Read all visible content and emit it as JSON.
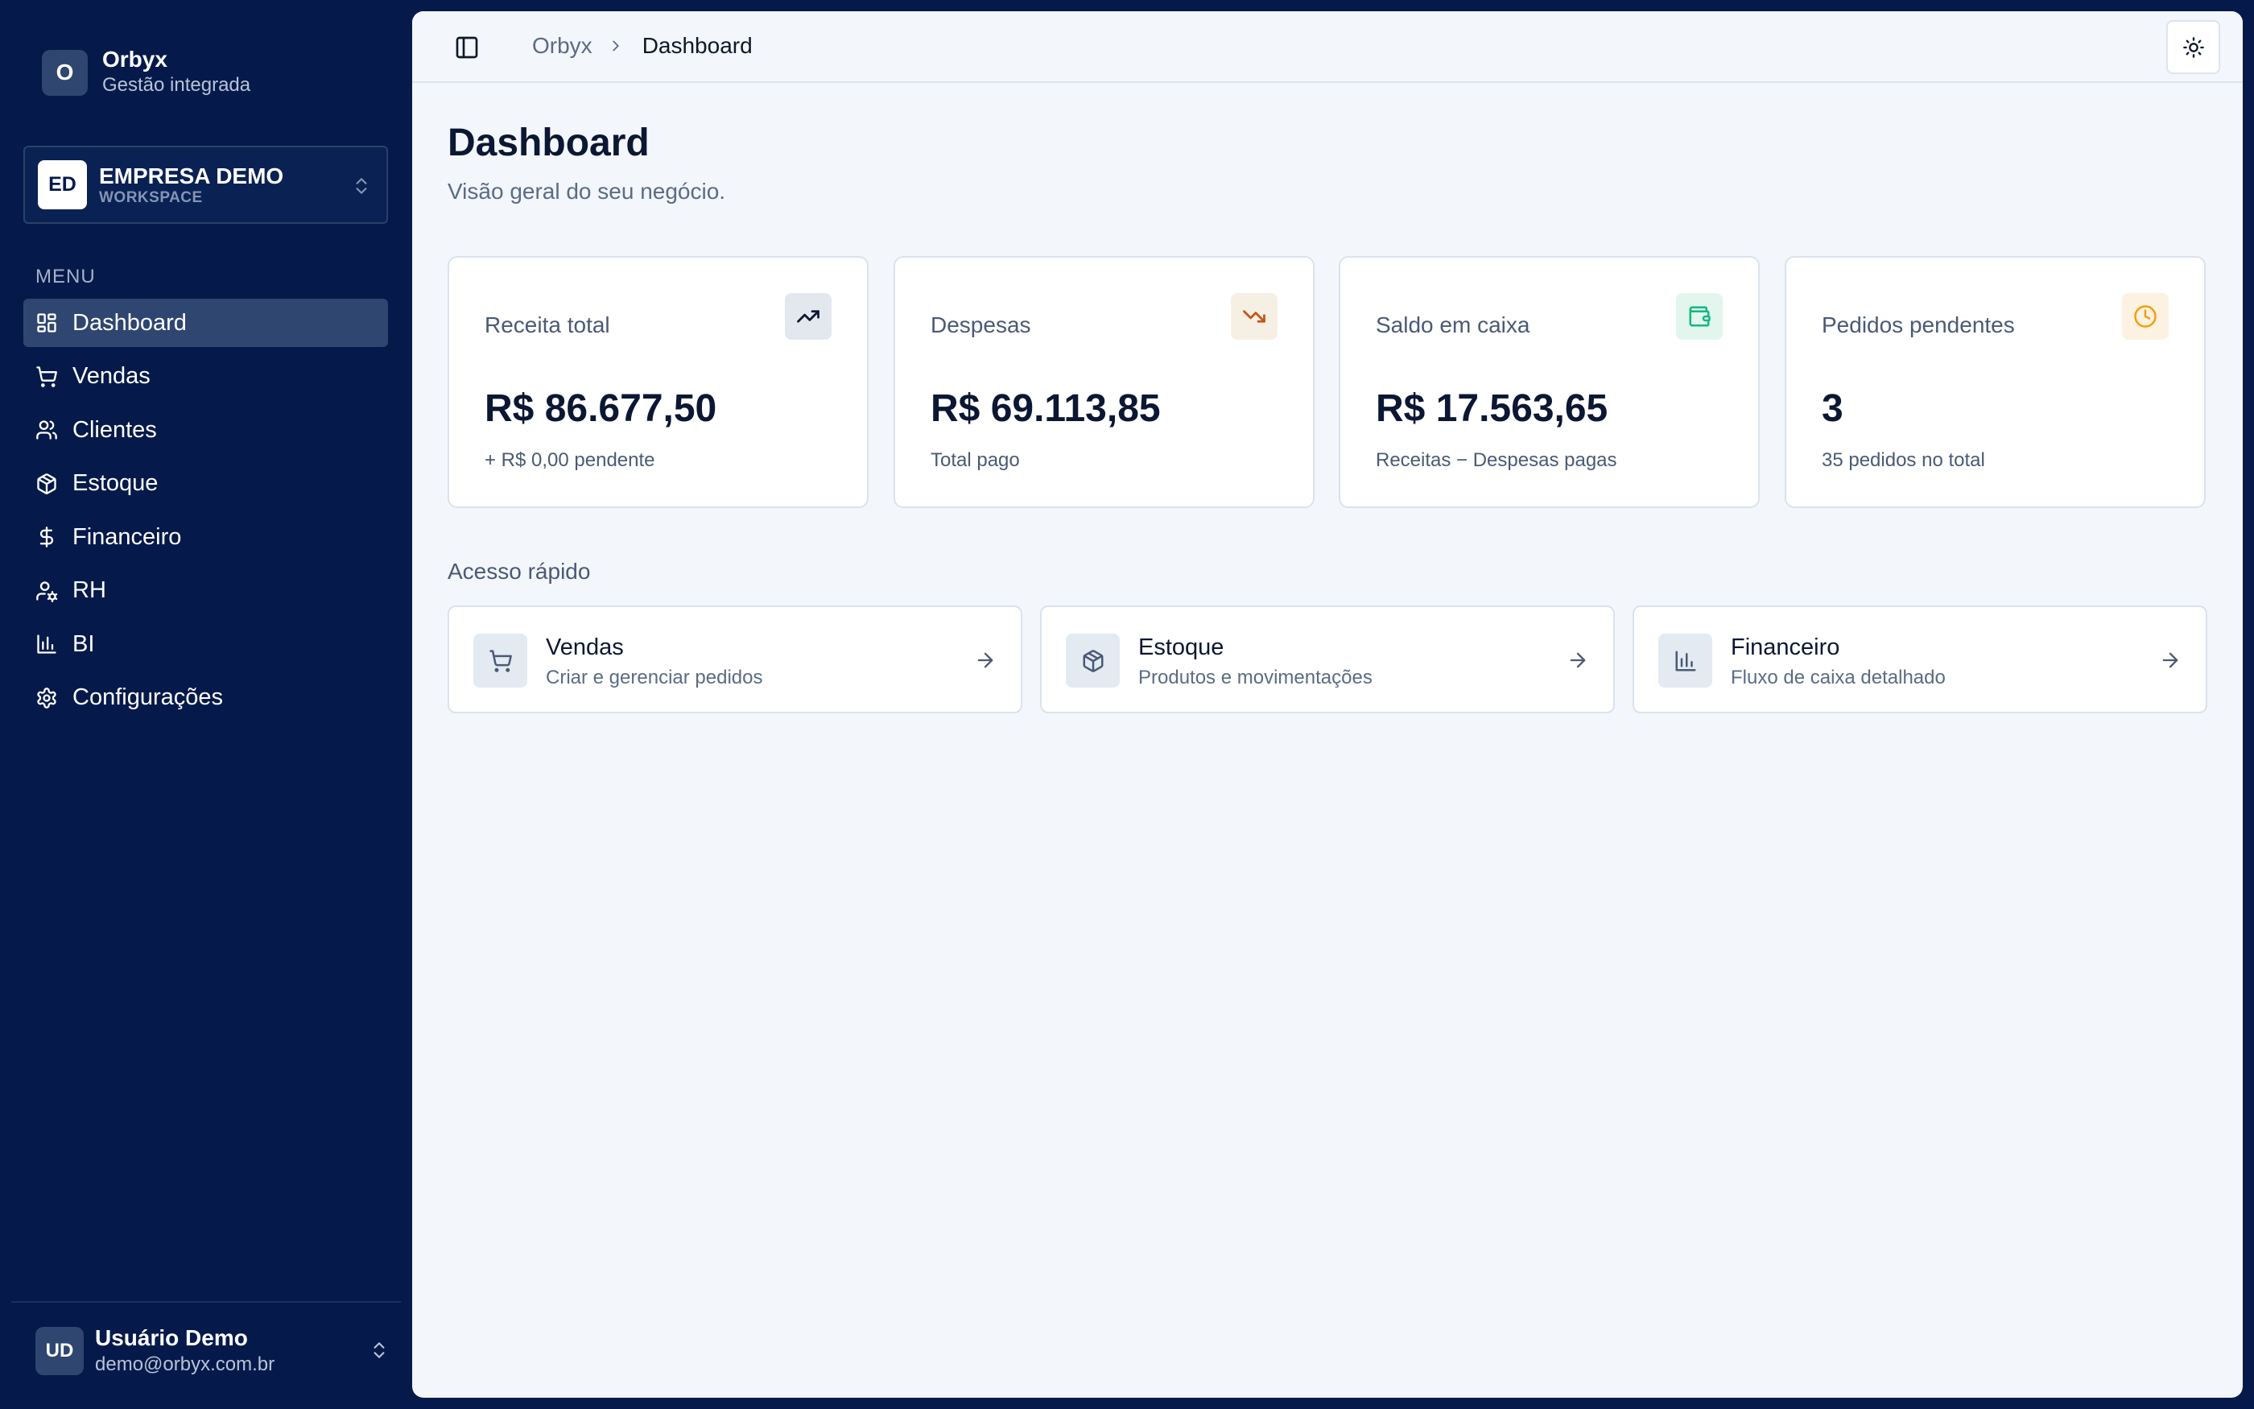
{
  "brand": {
    "initial": "O",
    "name": "Orbyx",
    "subtitle": "Gestão integrada"
  },
  "workspace": {
    "badge": "ED",
    "name": "EMPRESA DEMO",
    "type": "WORKSPACE"
  },
  "sidebar": {
    "menu_label": "MENU",
    "items": [
      {
        "label": "Dashboard",
        "icon": "layout-dashboard-icon",
        "active": true
      },
      {
        "label": "Vendas",
        "icon": "shopping-cart-icon"
      },
      {
        "label": "Clientes",
        "icon": "users-icon"
      },
      {
        "label": "Estoque",
        "icon": "package-icon"
      },
      {
        "label": "Financeiro",
        "icon": "dollar-sign-icon"
      },
      {
        "label": "RH",
        "icon": "user-cog-icon"
      },
      {
        "label": "BI",
        "icon": "bar-chart-icon"
      },
      {
        "label": "Configurações",
        "icon": "settings-icon"
      }
    ]
  },
  "user": {
    "initials": "UD",
    "name": "Usuário Demo",
    "email": "demo@orbyx.com.br"
  },
  "header": {
    "breadcrumb": [
      "Orbyx",
      "Dashboard"
    ]
  },
  "page": {
    "title": "Dashboard",
    "subtitle": "Visão geral do seu negócio."
  },
  "stats": [
    {
      "label": "Receita total",
      "value": "R$ 86.677,50",
      "note": "+ R$ 0,00 pendente",
      "icon": "trending-up-icon",
      "icon_color": "#0b1733",
      "icon_bg": "#e3e8ef"
    },
    {
      "label": "Despesas",
      "value": "R$ 69.113,85",
      "note": "Total pago",
      "icon": "trending-down-icon",
      "icon_color": "#c2571a",
      "icon_bg": "#f6efe3"
    },
    {
      "label": "Saldo em caixa",
      "value": "R$ 17.563,65",
      "note": "Receitas − Despesas pagas",
      "icon": "wallet-icon",
      "icon_color": "#10b981",
      "icon_bg": "#e2f6ee"
    },
    {
      "label": "Pedidos pendentes",
      "value": "3",
      "note": "35 pedidos no total",
      "icon": "clock-icon",
      "icon_color": "#f59e0b",
      "icon_bg": "#fcf2e2"
    }
  ],
  "quick_access": {
    "title": "Acesso rápido",
    "items": [
      {
        "title": "Vendas",
        "subtitle": "Criar e gerenciar pedidos",
        "icon": "shopping-cart-icon"
      },
      {
        "title": "Estoque",
        "subtitle": "Produtos e movimentações",
        "icon": "package-icon"
      },
      {
        "title": "Financeiro",
        "subtitle": "Fluxo de caixa detalhado",
        "icon": "bar-chart-icon"
      }
    ]
  }
}
